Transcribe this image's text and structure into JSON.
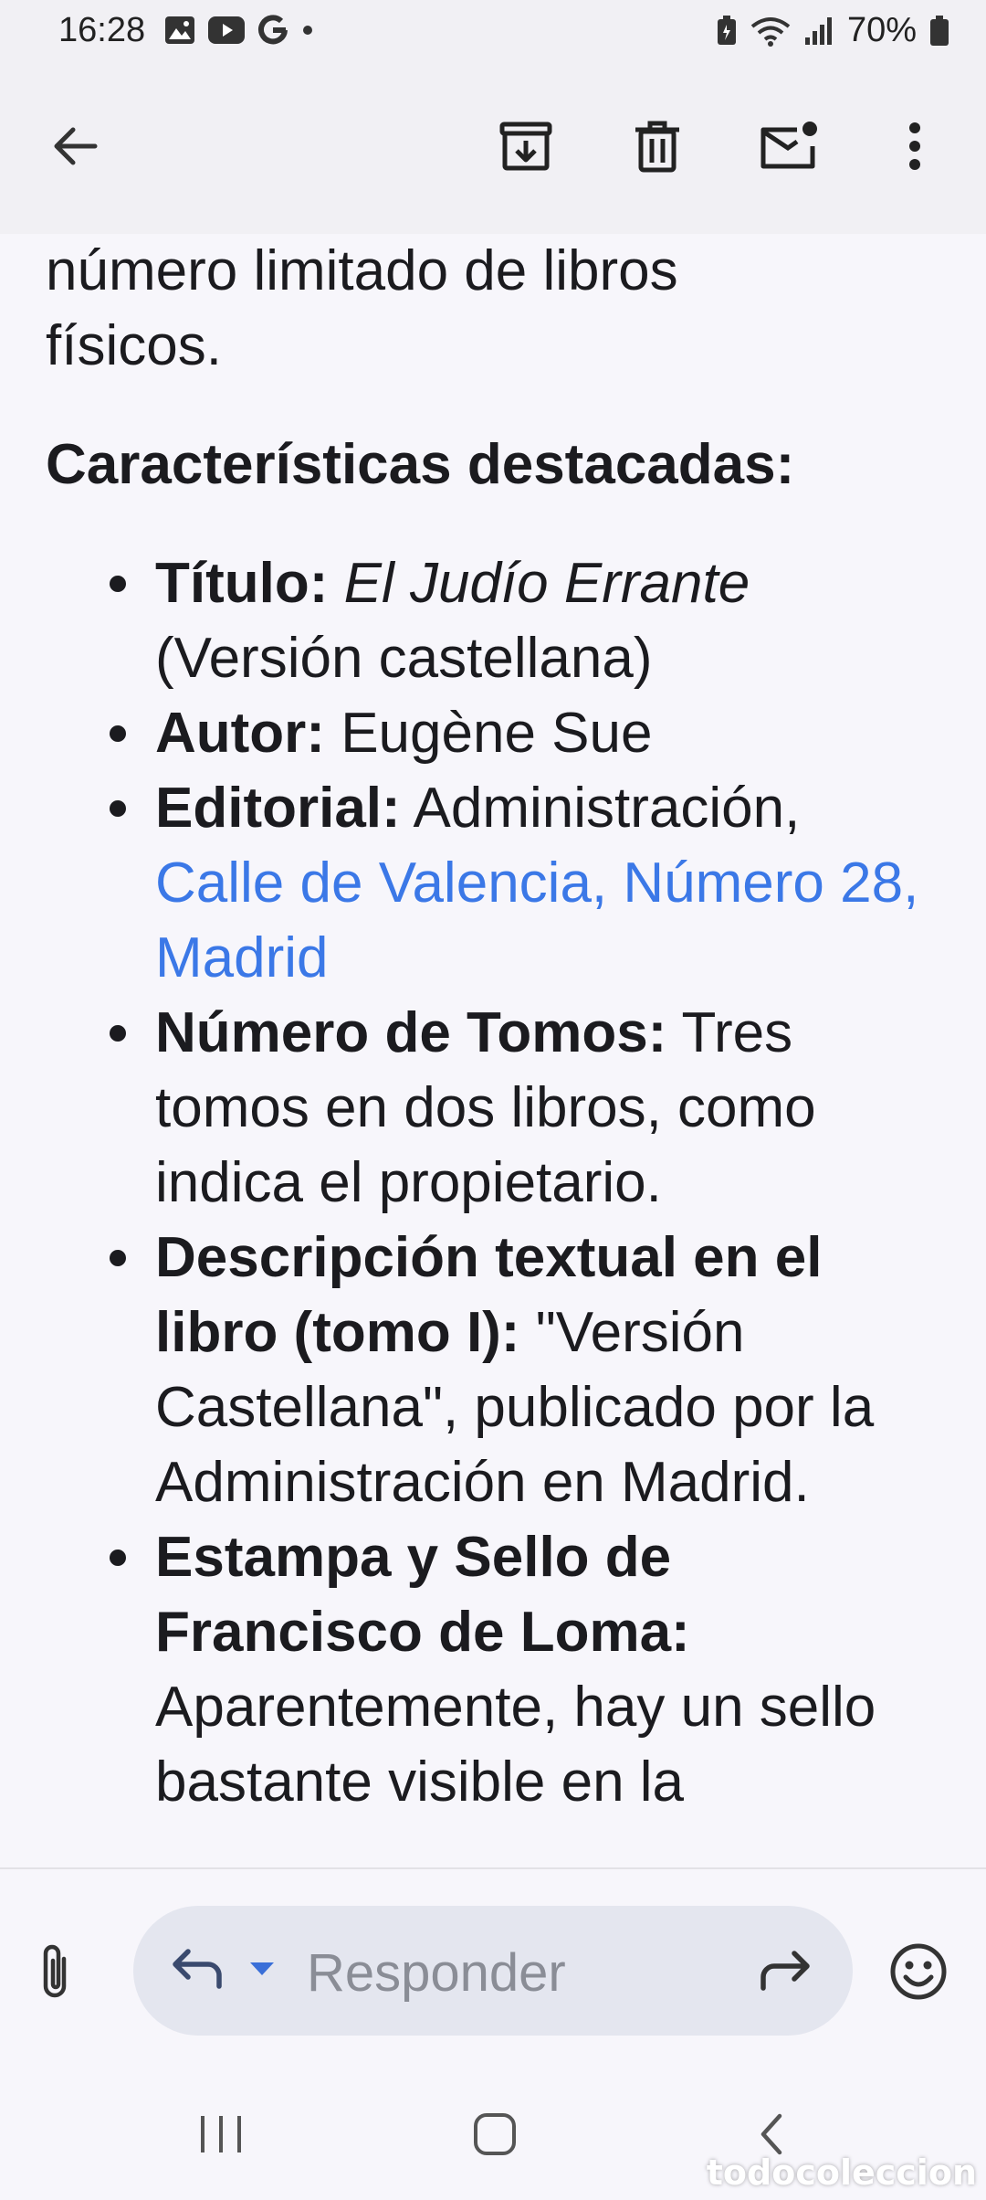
{
  "status_bar": {
    "time": "16:28",
    "battery": "70%",
    "left_icons": [
      "image-icon",
      "youtube-icon",
      "google-icon",
      "dot-icon"
    ],
    "right_icons": [
      "battery-saver-icon",
      "wifi-icon",
      "signal-icon",
      "battery-icon"
    ]
  },
  "app_bar": {
    "icons": [
      "back-arrow-icon",
      "archive-icon",
      "delete-icon",
      "mark-unread-icon",
      "more-vert-icon"
    ]
  },
  "email": {
    "intro_line1": "número limitado de libros",
    "intro_line2": "físicos.",
    "heading": "Características destacadas:",
    "items": [
      {
        "label": "Título:",
        "value_italic": "El Judío Errante",
        "value": "(Versión castellana)"
      },
      {
        "label": "Autor:",
        "value": "Eugène Sue"
      },
      {
        "label": "Editorial:",
        "value": "Administración,",
        "link": "Calle de Valencia, Número 28, Madrid"
      },
      {
        "label": "Número de Tomos:",
        "value": "Tres tomos en dos libros, como indica el propietario."
      },
      {
        "label": "Descripción textual en el libro (tomo I):",
        "value": "\"Versión Castellana\", publicado por la Administración en Madrid."
      },
      {
        "label": "Estampa y Sello de Francisco de Loma:",
        "value": "Aparentemente, hay un sello bastante visible en la"
      }
    ]
  },
  "compose": {
    "placeholder": "Responder",
    "icons": [
      "attach-icon",
      "reply-icon",
      "dropdown-icon",
      "forward-icon",
      "emoji-icon"
    ]
  },
  "watermark": "todocoleccion",
  "colors": {
    "link": "#3b78e7",
    "app_bar_bg": "#f1f0f4",
    "pill_bg": "#e4e6ef"
  }
}
